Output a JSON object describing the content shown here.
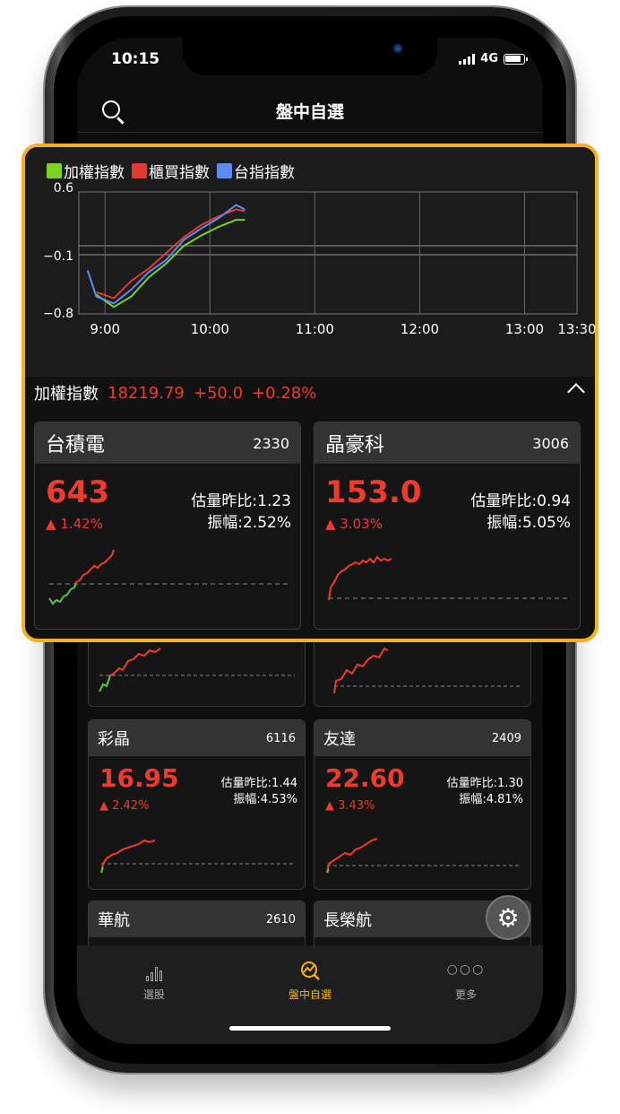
{
  "status": {
    "time": "10:15",
    "network": "4G"
  },
  "header": {
    "title": "盤中自選"
  },
  "legend": [
    {
      "label": "加權指數",
      "color": "#7ed321"
    },
    {
      "label": "櫃買指數",
      "color": "#e53935"
    },
    {
      "label": "台指指數",
      "color": "#5b8def"
    }
  ],
  "chart_data": {
    "type": "line",
    "x_ticks": [
      "9:00",
      "10:00",
      "11:00",
      "12:00",
      "13:00",
      "13:30"
    ],
    "y_ticks": [
      "0.6",
      "−0.1",
      "−0.8"
    ],
    "ylim": [
      -0.8,
      0.6
    ],
    "grid": true,
    "series": [
      {
        "name": "加權指數",
        "color": "#7ed321",
        "x": [
          "8:55",
          "9:05",
          "9:15",
          "9:25",
          "9:35",
          "9:45",
          "9:55",
          "10:05",
          "10:15",
          "10:20"
        ],
        "values": [
          -0.58,
          -0.72,
          -0.6,
          -0.38,
          -0.22,
          -0.02,
          0.1,
          0.2,
          0.28,
          0.28
        ]
      },
      {
        "name": "櫃買指數",
        "color": "#e53935",
        "x": [
          "8:55",
          "9:05",
          "9:15",
          "9:25",
          "9:35",
          "9:45",
          "9:55",
          "10:05",
          "10:15",
          "10:20"
        ],
        "values": [
          -0.55,
          -0.62,
          -0.42,
          -0.28,
          -0.1,
          0.08,
          0.22,
          0.32,
          0.4,
          0.38
        ]
      },
      {
        "name": "台指指數",
        "color": "#5b8def",
        "x": [
          "8:50",
          "8:55",
          "9:05",
          "9:15",
          "9:25",
          "9:35",
          "9:45",
          "9:55",
          "10:05",
          "10:15",
          "10:20"
        ],
        "values": [
          -0.3,
          -0.6,
          -0.68,
          -0.52,
          -0.32,
          -0.18,
          0.05,
          0.18,
          0.3,
          0.45,
          0.4
        ]
      }
    ]
  },
  "index_summary": {
    "name": "加權指數",
    "value": "18219.79",
    "change": "+50.0",
    "percent": "+0.28%"
  },
  "highlight_cards": [
    {
      "name": "台積電",
      "code": "2330",
      "price": "643",
      "pct": "▲ 1.42%",
      "vol": "估量昨比:1.23",
      "amp": "振幅:2.52%"
    },
    {
      "name": "晶豪科",
      "code": "3006",
      "price": "153.0",
      "pct": "▲ 3.03%",
      "vol": "估量昨比:0.94",
      "amp": "振幅:5.05%"
    }
  ],
  "background_cards": [
    {
      "name": "彩晶",
      "code": "6116",
      "price": "16.95",
      "pct": "▲ 2.42%",
      "vol": "估量昨比:1.44",
      "amp": "振幅:4.53%"
    },
    {
      "name": "友達",
      "code": "2409",
      "price": "22.60",
      "pct": "▲ 3.43%",
      "vol": "估量昨比:1.30",
      "amp": "振幅:4.81%"
    },
    {
      "name": "華航",
      "code": "2610"
    },
    {
      "name": "長榮航",
      "code": ""
    }
  ],
  "tabs": [
    {
      "label": "選股",
      "icon": "bar-chart-icon"
    },
    {
      "label": "盤中自選",
      "icon": "watchlist-chart-icon"
    },
    {
      "label": "更多",
      "icon": "more-dots-icon"
    }
  ],
  "colors": {
    "accent": "#f5b21a",
    "up": "#ef3a2e",
    "down": "#4cc24c"
  }
}
